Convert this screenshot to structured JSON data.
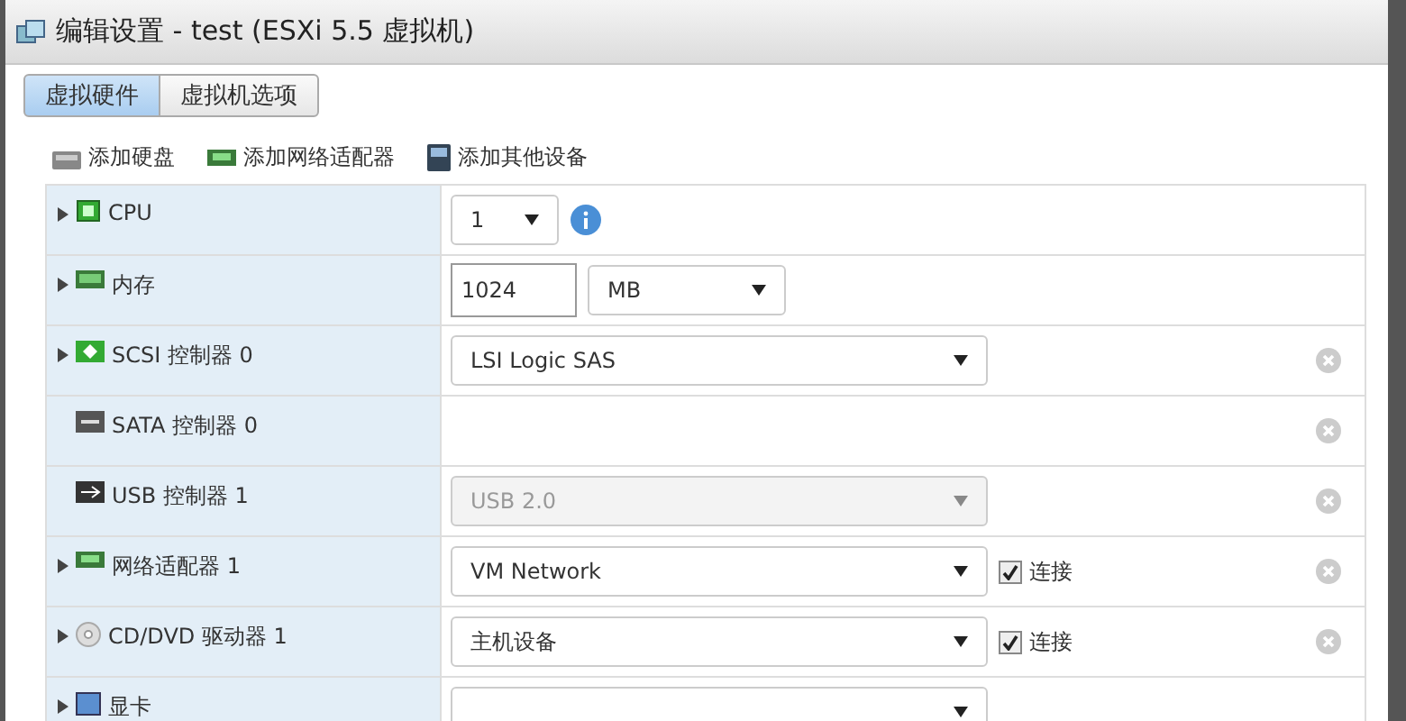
{
  "window": {
    "title": "编辑设置 - test (ESXi 5.5 虚拟机)"
  },
  "tabs": [
    {
      "label": "虚拟硬件",
      "selected": true
    },
    {
      "label": "虚拟机选项",
      "selected": false
    }
  ],
  "toolbar": [
    "添加硬盘",
    "添加网络适配器",
    "添加其他设备"
  ],
  "devices": [
    {
      "name": "CPU",
      "expandable": true,
      "removable": false,
      "kind": "select-info",
      "value": "1"
    },
    {
      "name": "内存",
      "expandable": true,
      "removable": false,
      "kind": "input-unit",
      "value": "1024",
      "unit": "MB"
    },
    {
      "name": "SCSI 控制器 0",
      "expandable": true,
      "removable": true,
      "kind": "select",
      "value": "LSI Logic SAS",
      "disabled": false
    },
    {
      "name": "SATA 控制器 0",
      "expandable": false,
      "removable": true,
      "kind": "none"
    },
    {
      "name": "USB 控制器 1",
      "expandable": false,
      "removable": true,
      "kind": "select",
      "value": "USB 2.0",
      "disabled": true
    },
    {
      "name": "网络适配器 1",
      "expandable": true,
      "removable": true,
      "kind": "select-check",
      "value": "VM Network",
      "check_label": "连接",
      "checked": true
    },
    {
      "name": "CD/DVD 驱动器 1",
      "expandable": true,
      "removable": true,
      "kind": "select-check",
      "value": "主机设备",
      "check_label": "连接",
      "checked": true
    },
    {
      "name": "显卡",
      "expandable": true,
      "removable": false,
      "kind": "select",
      "disabled": false
    }
  ]
}
